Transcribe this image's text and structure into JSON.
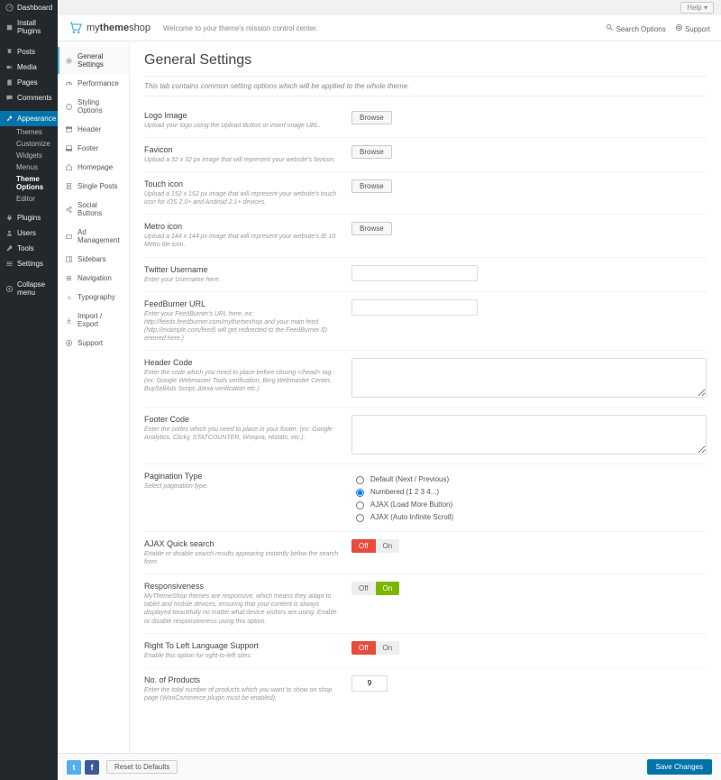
{
  "topbar": {
    "help": "Help"
  },
  "wp_menu": {
    "dashboard": "Dashboard",
    "install_plugins": "Install Plugins",
    "posts": "Posts",
    "media": "Media",
    "pages": "Pages",
    "comments": "Comments",
    "appearance": "Appearance",
    "appearance_sub": {
      "themes": "Themes",
      "customize": "Customize",
      "widgets": "Widgets",
      "menus": "Menus",
      "theme_options": "Theme Options",
      "editor": "Editor"
    },
    "plugins": "Plugins",
    "users": "Users",
    "tools": "Tools",
    "settings": "Settings",
    "collapse": "Collapse menu"
  },
  "header": {
    "logo_text_1": "my",
    "logo_text_2": "theme",
    "logo_text_3": "shop",
    "tagline": "Welcome to your theme's mission control center.",
    "search": "Search Options",
    "support": "Support"
  },
  "opt_menu": {
    "general": "General Settings",
    "performance": "Performance",
    "styling": "Styling Options",
    "header_opt": "Header",
    "footer_opt": "Footer",
    "homepage": "Homepage",
    "single": "Single Posts",
    "social": "Social Buttons",
    "ad": "Ad Management",
    "sidebars": "Sidebars",
    "navigation": "Navigation",
    "typography": "Typography",
    "import": "Import / Export",
    "support_opt": "Support"
  },
  "page": {
    "title": "General Settings",
    "intro": "This tab contains common setting options which will be applied to the whole theme.",
    "browse": "Browse",
    "logo": {
      "label": "Logo Image",
      "desc": "Upload your logo using the Upload Button or insert image URL."
    },
    "favicon": {
      "label": "Favicon",
      "desc": "Upload a 32 x 32 px image that will represent your website's favicon."
    },
    "touch": {
      "label": "Touch icon",
      "desc": "Upload a 152 x 152 px image that will represent your website's touch icon for iOS 2.0+ and Android 2.1+ devices."
    },
    "metro": {
      "label": "Metro icon",
      "desc": "Upload a 144 x 144 px image that will represent your website's IE 10 Metro tile icon."
    },
    "twitter": {
      "label": "Twitter Username",
      "desc": "Enter your Username here."
    },
    "feedburner": {
      "label": "FeedBurner URL",
      "desc": "Enter your FeedBurner's URL here, ex: http://feeds.feedburner.com/mythemeshop and your main feed (http://example.com/feed) will get redirected to the FeedBurner ID entered here.)"
    },
    "header_code": {
      "label": "Header Code",
      "desc": "Enter the code which you need to place before closing </head> tag. (ex: Google Webmaster Tools verification, Bing Webmaster Center, BuySellAds Script, Alexa verification etc.)"
    },
    "footer_code": {
      "label": "Footer Code",
      "desc": "Enter the codes which you need to place in your footer. (ex: Google Analytics, Clicky, STATCOUNTER, Woopra, Histats, etc.)."
    },
    "pagination": {
      "label": "Pagination Type",
      "desc": "Select pagination type.",
      "opt1": "Default (Next / Previous)",
      "opt2": "Numbered (1 2 3 4...)",
      "opt3": "AJAX (Load More Button)",
      "opt4": "AJAX (Auto Infinite Scroll)"
    },
    "ajax_search": {
      "label": "AJAX Quick search",
      "desc": "Enable or disable search results appearing instantly below the search form"
    },
    "responsive": {
      "label": "Responsiveness",
      "desc": "MyThemeShop themes are responsive, which means they adapt to tablet and mobile devices, ensuring that your content is always displayed beautifully no matter what device visitors are using. Enable or disable responsiveness using this option."
    },
    "rtl": {
      "label": "Right To Left Language Support",
      "desc": "Enable this option for right-to-left sites."
    },
    "products": {
      "label": "No. of Products",
      "desc": "Enter the total number of products which you want to show on shop page (WooCommerce plugin must be enabled).",
      "value": "9"
    },
    "toggle_on": "On",
    "toggle_off": "Off"
  },
  "footer": {
    "reset": "Reset to Defaults",
    "save": "Save Changes"
  }
}
